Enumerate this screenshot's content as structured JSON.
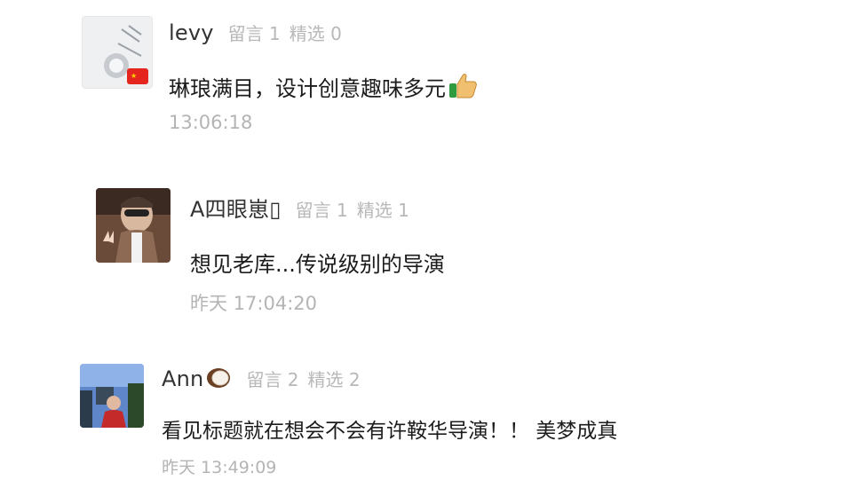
{
  "comments": [
    {
      "name": "levy",
      "stats": {
        "replies": "留言 1",
        "featured": "精选 0"
      },
      "text": "琳琅满目，设计创意趣味多元",
      "emoji": "thumbs-up",
      "time": "13:06:18"
    },
    {
      "name": "A四眼崽▯",
      "stats": {
        "replies": "留言 1",
        "featured": "精选 1"
      },
      "text": "想见老库...传说级别的导演",
      "time": "昨天 17:04:20"
    },
    {
      "name": "Ann",
      "name_emoji": "coconut",
      "stats": {
        "replies": "留言 2",
        "featured": "精选 2"
      },
      "text": "看见标题就在想会不会有许鞍华导演！！ 美梦成真",
      "time": "昨天 13:49:09"
    }
  ]
}
